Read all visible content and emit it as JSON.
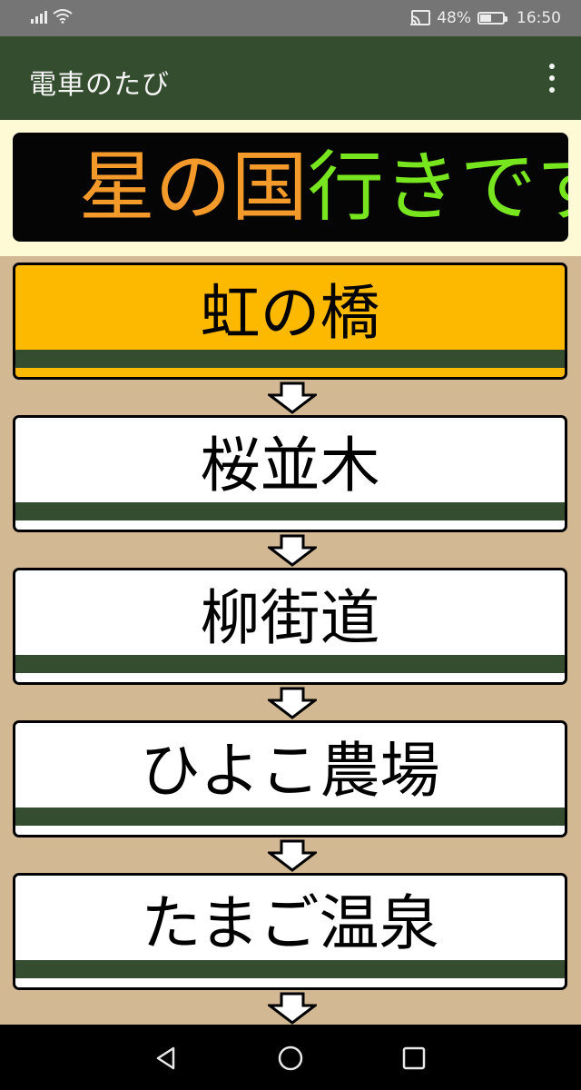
{
  "status_bar": {
    "battery_percent": "48%",
    "battery_level": 0.48,
    "time": "16:50",
    "icons": [
      "signal-icon",
      "wifi-icon",
      "cast-icon",
      "battery-icon"
    ]
  },
  "app_bar": {
    "title": "電車のたび",
    "menu_icon": "more-vert-icon"
  },
  "banner": {
    "bracket": "】",
    "destination": "星の国",
    "suffix": "行きです",
    "colors": {
      "destination": "#f39a2b",
      "suffix": "#78e61e",
      "background": "#050505"
    }
  },
  "stations": [
    {
      "name": "虹の橋",
      "current": true
    },
    {
      "name": "桜並木",
      "current": false
    },
    {
      "name": "柳街道",
      "current": false
    },
    {
      "name": "ひよこ農場",
      "current": false
    },
    {
      "name": "たまご温泉",
      "current": false
    }
  ],
  "colors": {
    "app_bar": "#344d2f",
    "list_background": "#d2b994",
    "current_station": "#fdb900",
    "stripe": "#344d2f"
  },
  "nav_bar": {
    "icons": [
      "back-icon",
      "home-icon",
      "recents-icon"
    ]
  }
}
